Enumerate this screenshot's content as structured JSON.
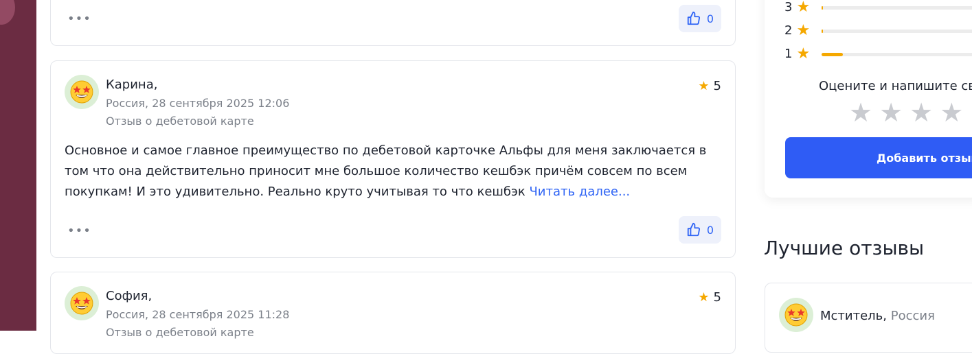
{
  "reviews": [
    {
      "like_count": "0"
    },
    {
      "author": "Карина,",
      "location_date": "Россия, 28 сентября 2025 12:06",
      "category": "Отзыв о дебетовой карте",
      "rating": "5",
      "text": "Основное и самое главное преимущество по дебетовой карточке Альфы для меня заключается в том что она действительно приносит мне большое количество кешбэк причём совсем по всем покупкам! И это удивительно. Реально круто учитывая то что кешбэк ",
      "read_more": "Читать далее...",
      "like_count": "0"
    },
    {
      "author": "София,",
      "location_date": "Россия, 28 сентября 2025 11:28",
      "category": "Отзыв о дебетовой карте",
      "rating": "5"
    }
  ],
  "rating_distribution": [
    {
      "stars": "3",
      "fraction": 0.0
    },
    {
      "stars": "2",
      "fraction": 0.01
    },
    {
      "stars": "1",
      "fraction": 0.13
    }
  ],
  "rate_prompt": "Оцените и напишите сво",
  "add_review_label": "Добавить отзыв",
  "best_reviews_title": "Лучшие отзывы",
  "best_review": {
    "author": "Мститель,",
    "location": "Россия"
  },
  "colors": {
    "accent": "#2f5cf5",
    "star": "#f5a800",
    "link": "#2f64f5",
    "sidebar_bg": "#6b2c42"
  },
  "icons": {
    "like": "thumbs-up-icon",
    "avatar": "star-struck-emoji-icon",
    "more": "more-dots-icon",
    "star": "star-icon"
  }
}
